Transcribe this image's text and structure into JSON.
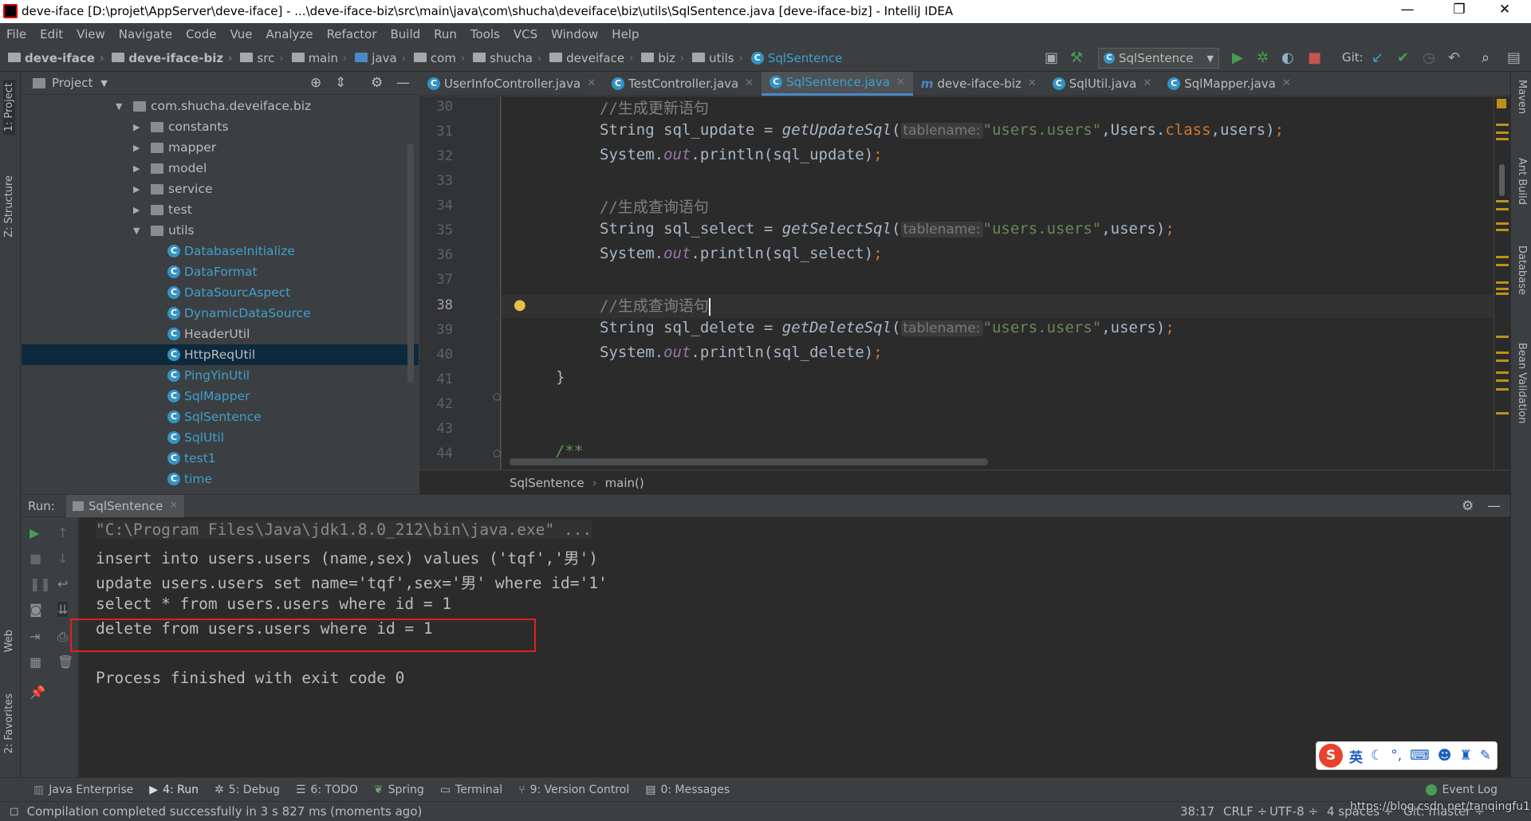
{
  "window": {
    "title": "deve-iface [D:\\projet\\AppServer\\deve-iface] - ...\\deve-iface-biz\\src\\main\\java\\com\\shucha\\deveiface\\biz\\utils\\SqlSentence.java [deve-iface-biz] - IntelliJ IDEA",
    "minimize": "—",
    "restore": "❐",
    "close": "✕"
  },
  "menu": [
    "File",
    "Edit",
    "View",
    "Navigate",
    "Code",
    "Vue",
    "Analyze",
    "Refactor",
    "Build",
    "Run",
    "Tools",
    "VCS",
    "Window",
    "Help"
  ],
  "nav": {
    "crumbs": [
      "deve-iface",
      "deve-iface-biz",
      "src",
      "main",
      "java",
      "com",
      "shucha",
      "deveiface",
      "biz",
      "utils"
    ],
    "current": "SqlSentence",
    "run_config": "SqlSentence",
    "git_label": "Git:"
  },
  "sidebar_left": {
    "project": "1: Project",
    "structure": "Z: Structure",
    "web": "Web",
    "favorites": "2: Favorites"
  },
  "sidebar_right": {
    "maven": "Maven",
    "ant": "Ant Build",
    "database": "Database",
    "bean": "Bean Validation"
  },
  "project_panel": {
    "title": "Project",
    "root": "com.shucha.deveiface.biz",
    "folders": [
      "constants",
      "mapper",
      "model",
      "service",
      "test"
    ],
    "open_folder": "utils",
    "classes": [
      "DatabaseInitialize",
      "DataFormat",
      "DataSourcAspect",
      "DynamicDataSource",
      "HeaderUtil",
      "HttpReqUtil",
      "PingYinUtil",
      "SqlMapper",
      "SqlSentence",
      "SqlUtil",
      "test1",
      "time"
    ],
    "selected": "HttpReqUtil"
  },
  "editor": {
    "tabs": [
      {
        "label": "UserInfoController.java",
        "icon": "C"
      },
      {
        "label": "TestController.java",
        "icon": "C"
      },
      {
        "label": "SqlSentence.java",
        "icon": "C"
      },
      {
        "label": "deve-iface-biz",
        "icon": "m"
      },
      {
        "label": "SqlUtil.java",
        "icon": "C"
      },
      {
        "label": "SqlMapper.java",
        "icon": "C"
      }
    ],
    "active_tab": "SqlSentence.java",
    "line_numbers": [
      "30",
      "31",
      "32",
      "33",
      "34",
      "35",
      "36",
      "37",
      "38",
      "39",
      "40",
      "41",
      "42",
      "43",
      "44"
    ],
    "lines": {
      "l30": "//生成更新语句",
      "l31a": "String sql_update = ",
      "l31f": "getUpdateSql",
      "l31h": "tablename:",
      "l31s": "\"users.users\"",
      "l31b": ",Users.",
      "l31k": "class",
      "l31c": ",users)",
      "l32a": "System.",
      "l32o": "out",
      "l32b": ".println(sql_update)",
      "l34": "//生成查询语句",
      "l35a": "String sql_select = ",
      "l35f": "getSelectSql",
      "l35h": "tablename:",
      "l35s": "\"users.users\"",
      "l35c": ",users)",
      "l36a": "System.",
      "l36o": "out",
      "l36b": ".println(sql_select)",
      "l38": "//生成查询语句",
      "l39a": "String sql_delete = ",
      "l39f": "getDeleteSql",
      "l39h": "tablename:",
      "l39s": "\"users.users\"",
      "l39c": ",users)",
      "l40a": "System.",
      "l40o": "out",
      "l40b": ".println(sql_delete)",
      "l41": "}",
      "l44": "/**"
    },
    "breadcrumb": [
      "SqlSentence",
      "main()"
    ]
  },
  "run": {
    "label": "Run:",
    "tab": "SqlSentence",
    "output": [
      "\"C:\\Program Files\\Java\\jdk1.8.0_212\\bin\\java.exe\" ...",
      "insert into users.users (name,sex) values ('tqf','男')",
      "update users.users set name='tqf',sex='男' where id='1'",
      "select * from users.users where id = 1",
      "delete from users.users where id = 1",
      "",
      "Process finished with exit code 0"
    ]
  },
  "tool_windows": [
    {
      "label": "Java Enterprise"
    },
    {
      "label": "4: Run"
    },
    {
      "label": "5: Debug"
    },
    {
      "label": "6: TODO"
    },
    {
      "label": "Spring"
    },
    {
      "label": "Terminal"
    },
    {
      "label": "9: Version Control"
    },
    {
      "label": "0: Messages"
    }
  ],
  "event_log": "Event Log",
  "status": {
    "message": "Compilation completed successfully in 3 s 827 ms (moments ago)",
    "position": "38:17",
    "line_sep": "CRLF ÷",
    "encoding": "UTF-8 ÷",
    "indent": "4 spaces ÷",
    "git": "Git: master ÷",
    "watermark": "https://blog.csdn.net/tanqingfu1"
  },
  "ime": {
    "lang": "英",
    "logo": "S"
  },
  "colors": {
    "accent": "#4a88c7",
    "class_blue": "#3f9fcf",
    "highlight_box": "#e02020",
    "run_green": "#499c54"
  }
}
